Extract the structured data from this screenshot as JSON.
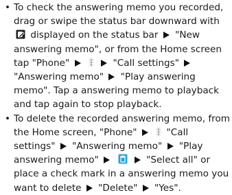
{
  "document": {
    "bullet_char": "•",
    "items": [
      {
        "t1": "To check the answering memo you recorded, drag or swipe the status bar downward with",
        "t2": "displayed on the status bar",
        "t3": "\"New answering memo\", or from the Home screen tap \"Phone\"",
        "t4": "\"Call settings\"",
        "t5": "\"Answering memo\"",
        "t6": "\"Play answering memo\". Tap a answering memo to playback and tap again to stop playback."
      },
      {
        "t1": "To delete the recorded answering memo, from the Home screen, \"Phone\"",
        "t2": "\"Call settings\"",
        "t3": "\"Answering memo\"",
        "t4": "\"Play answering memo\"",
        "t5": "\"Select all\" or place a check mark in a answering memo you want to delete",
        "t6": "\"Delete\"",
        "t7": "\"Yes\"."
      }
    ],
    "icons": {
      "memo_icon": "answering-memo-notification-icon",
      "menu_icon": "menu-dots-icon",
      "trash_icon": "delete-icon"
    },
    "colors": {
      "text": "#1a1a1a",
      "memo_icon_bg": "#1f1f1f",
      "menu_icon": "#9a9a9a",
      "trash_icon": "#29a3d6"
    }
  }
}
